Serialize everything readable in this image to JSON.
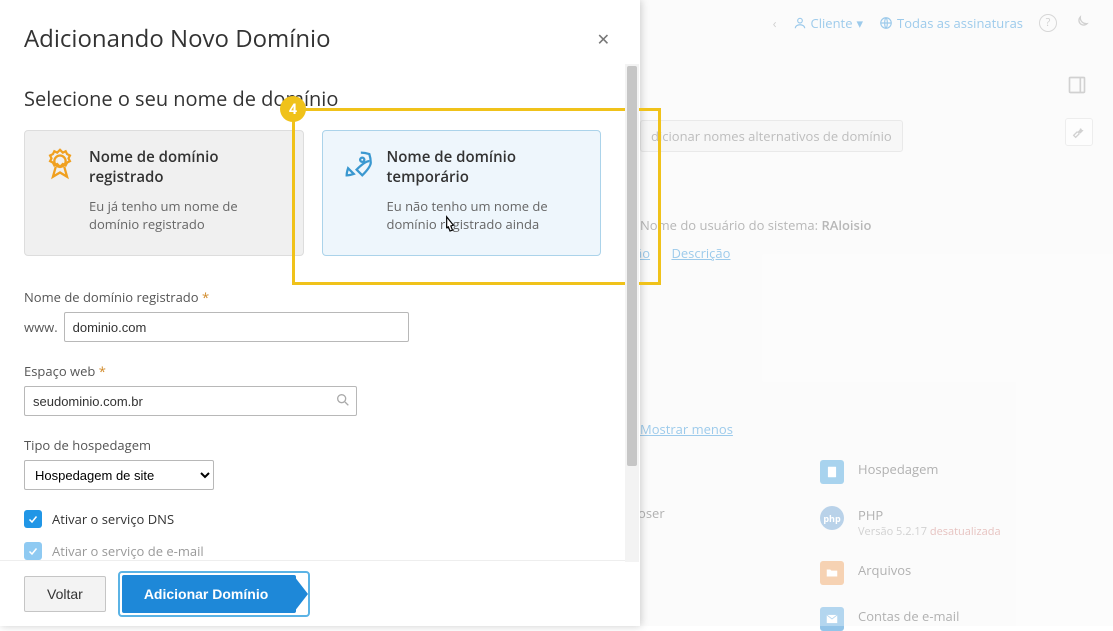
{
  "bg": {
    "client": "Cliente",
    "subscriptions": "Todas as assinaturas",
    "altnames": "dicionar nomes alternativos de domínio",
    "sysuser_label": "Nome do usuário do sistema: ",
    "sysuser_value": "RAloisio",
    "tab_ao": "ão",
    "tab_desc": "Descrição",
    "show_less": "Mostrar menos",
    "left_app": "oser",
    "apps": {
      "hosting": "Hospedagem",
      "php": "PHP",
      "php_sub": "Versão 5.2.17 ",
      "php_warn": "desatualizada",
      "files": "Arquivos",
      "mail": "Contas de e-mail"
    }
  },
  "modal": {
    "title": "Adicionando Novo Domínio",
    "section": "Selecione o seu nome de domínio",
    "highlight_num": "4",
    "card_reg": {
      "title": "Nome de domínio registrado",
      "desc": "Eu já tenho um nome de domínio registrado"
    },
    "card_tmp": {
      "title": "Nome de domínio temporário",
      "desc": "Eu não tenho um nome de domínio registrado ainda"
    },
    "f_domain_label": "Nome de domínio registrado",
    "www": "www.",
    "domain_value": "dominio.com",
    "f_web_label": "Espaço web",
    "web_value": "seudominio.com.br",
    "f_hosting_label": "Tipo de hospedagem",
    "hosting_value": "Hospedagem de site",
    "chk_dns": "Ativar o serviço DNS",
    "chk_mail": "Ativar o serviço de e-mail",
    "btn_back": "Voltar",
    "btn_add": "Adicionar Domínio"
  }
}
